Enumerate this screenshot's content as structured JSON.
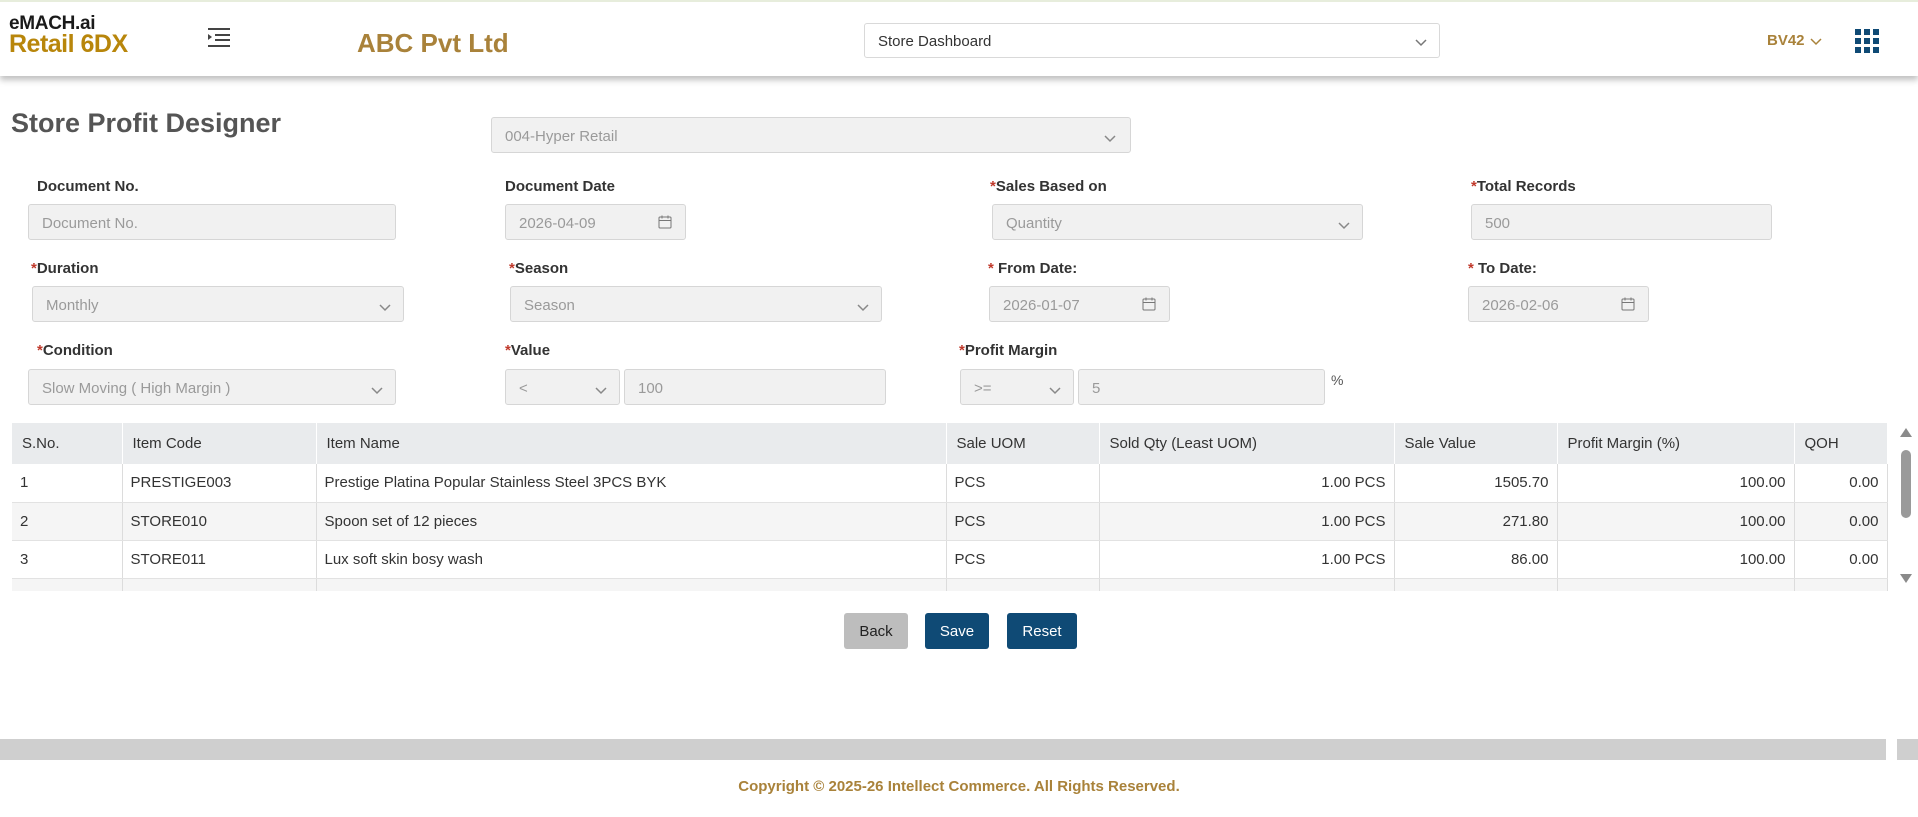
{
  "app": {
    "logo_top": "eMACH.ai",
    "logo_bottom": "Retail 6DX",
    "company": "ABC Pvt Ltd"
  },
  "header": {
    "dashboard_value": "Store Dashboard",
    "user_code": "BV42"
  },
  "page": {
    "title": "Store Profit Designer",
    "store_value": "004-Hyper Retail"
  },
  "form": {
    "doc_no_label": "Document No.",
    "doc_no_placeholder": "Document No.",
    "doc_date_label": "Document Date",
    "doc_date_value": "2026-04-09",
    "sales_based_label": "Sales Based on",
    "sales_based_value": "Quantity",
    "total_records_label": "Total Records",
    "total_records_value": "500",
    "duration_label": "Duration",
    "duration_value": "Monthly",
    "season_label": "Season",
    "season_value": "Season",
    "from_date_label": " From Date:",
    "from_date_value": "2026-01-07",
    "to_date_label": " To Date:",
    "to_date_value": "2026-02-06",
    "condition_label": "Condition",
    "condition_value": "Slow Moving ( High Margin )",
    "value_label": "Value",
    "value_operator": "<",
    "value_value": "100",
    "profit_margin_label": "Profit Margin",
    "profit_operator": ">=",
    "profit_value": "5",
    "percent_sign": "%",
    "required_mark": "*"
  },
  "table": {
    "headers": [
      "S.No.",
      "Item Code",
      "Item Name",
      "Sale UOM",
      "Sold Qty (Least UOM)",
      "Sale Value",
      "Profit Margin (%)",
      "QOH"
    ],
    "rows": [
      [
        "1",
        "PRESTIGE003",
        "Prestige Platina Popular Stainless Steel 3PCS BYK",
        "PCS",
        "1.00 PCS",
        "1505.70",
        "100.00",
        "0.00"
      ],
      [
        "2",
        "STORE010",
        "Spoon set of 12 pieces",
        "PCS",
        "1.00 PCS",
        "271.80",
        "100.00",
        "0.00"
      ],
      [
        "3",
        "STORE011",
        "Lux soft skin bosy wash",
        "PCS",
        "1.00 PCS",
        "86.00",
        "100.00",
        "0.00"
      ],
      [
        "",
        "",
        "",
        "",
        "",
        "",
        "",
        ""
      ]
    ]
  },
  "actions": {
    "back": "Back",
    "save": "Save",
    "reset": "Reset"
  },
  "footer": {
    "copyright": "Copyright © 2025-26 Intellect Commerce. All Rights Reserved."
  }
}
